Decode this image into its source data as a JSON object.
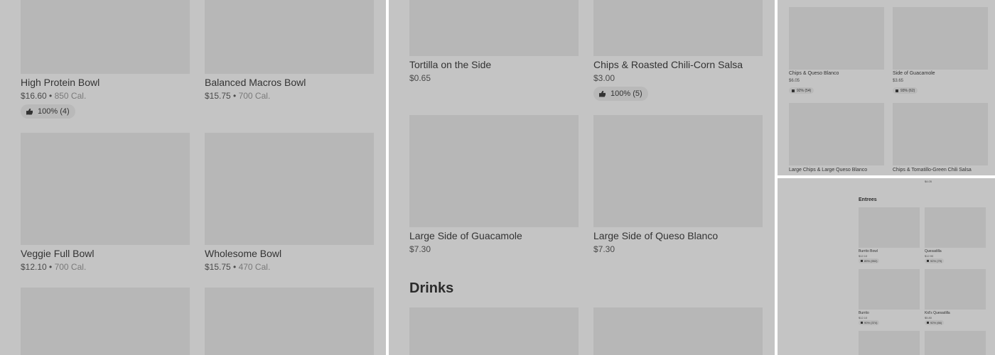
{
  "panel1": {
    "items": [
      {
        "name": "High Protein Bowl",
        "price": "$16.60",
        "calories": "850 Cal.",
        "rating": "100% (4)"
      },
      {
        "name": "Balanced Macros Bowl",
        "price": "$15.75",
        "calories": "700 Cal."
      },
      {
        "name": "Veggie Full Bowl",
        "price": "$12.10",
        "calories": "700 Cal."
      },
      {
        "name": "Wholesome Bowl",
        "price": "$15.75",
        "calories": "470 Cal."
      }
    ]
  },
  "panel2": {
    "items": [
      {
        "name": "Tortilla on the Side",
        "price": "$0.65"
      },
      {
        "name": "Chips & Roasted Chili-Corn Salsa",
        "price": "$3.00",
        "rating": "100% (5)"
      },
      {
        "name": "Large Side of Guacamole",
        "price": "$7.30"
      },
      {
        "name": "Large Side of Queso Blanco",
        "price": "$7.30"
      }
    ],
    "section_heading": "Drinks"
  },
  "panel3": {
    "items": [
      {
        "name": "Chips & Queso Blanco",
        "price": "$6.05",
        "rating": "92% (54)"
      },
      {
        "name": "Side of Guacamole",
        "price": "$3.65",
        "rating": "93% (62)"
      },
      {
        "name": "Large Chips & Large Queso Blanco"
      },
      {
        "name": "Chips & Tomatillo-Green Chili Salsa"
      }
    ]
  },
  "panel4": {
    "top_price": "$4.05",
    "section_heading": "Entrees",
    "items": [
      {
        "name": "Burrito Bowl",
        "price": "$12.10",
        "rating": "89% (552)"
      },
      {
        "name": "Quesadilla",
        "price": "$12.90",
        "rating": "92% (79)"
      },
      {
        "name": "Burrito",
        "price": "$12.10",
        "rating": "90% (374)"
      },
      {
        "name": "Kid's Quesadilla",
        "price": "$5.80",
        "rating": "92% (66)"
      }
    ]
  },
  "icons": {
    "rating": "thumbs-up-icon"
  }
}
